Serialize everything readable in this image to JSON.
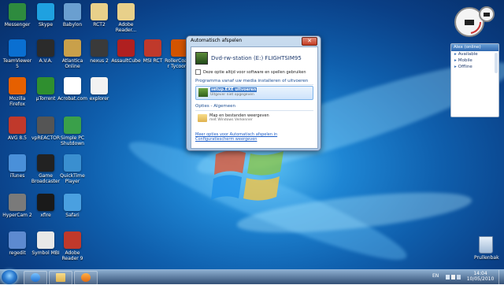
{
  "desktop_icons": [
    {
      "label": "Messenger",
      "color": "#2e8b3e",
      "icon": "messenger-icon"
    },
    {
      "label": "Skype",
      "color": "#1fa1e0",
      "icon": "skype-icon"
    },
    {
      "label": "Babylon",
      "color": "#6a9fd0",
      "icon": "babylon-icon"
    },
    {
      "label": "RCT2",
      "color": "#e8d08a",
      "icon": "folder-icon"
    },
    {
      "label": "Adobe Reader...",
      "color": "#e8d08a",
      "icon": "folder-icon"
    },
    {
      "label": "TeamViewer 5",
      "color": "#0a6fd1",
      "icon": "teamviewer-icon"
    },
    {
      "label": "A.V.A.",
      "color": "#2b2b2b",
      "icon": "ava-icon"
    },
    {
      "label": "Atlantica Online",
      "color": "#c9a04a",
      "icon": "atlantica-icon"
    },
    {
      "label": "nexus 2",
      "color": "#3a3a3a",
      "icon": "nexus-icon"
    },
    {
      "label": "AssaultCube",
      "color": "#b02020",
      "icon": "assaultcube-icon"
    },
    {
      "label": "MSI RCT",
      "color": "#c0392b",
      "icon": "msi-icon"
    },
    {
      "label": "RollerCoaster Tycoon 3",
      "color": "#d35400",
      "icon": "rct3-icon"
    },
    {
      "label": "Mozilla Firefox",
      "color": "#e66000",
      "icon": "firefox-icon"
    },
    {
      "label": "µTorrent",
      "color": "#2f8f2f",
      "icon": "utorrent-icon"
    },
    {
      "label": "Acrobat.com",
      "color": "#ffffff",
      "icon": "acrobat-icon"
    },
    {
      "label": "explorer",
      "color": "#f2f2f2",
      "icon": "explorer-icon"
    },
    {
      "label": "AVG 8.5",
      "color": "#c0392b",
      "icon": "avg-icon"
    },
    {
      "label": "vpREACTOR",
      "color": "#555555",
      "icon": "vpreactor-icon"
    },
    {
      "label": "Simple PC Shutdown",
      "color": "#3aa04a",
      "icon": "shutdown-icon"
    },
    {
      "label": "iTunes",
      "color": "#4a90d9",
      "icon": "itunes-icon"
    },
    {
      "label": "Game Broadcaster",
      "color": "#222222",
      "icon": "gamebroadcaster-icon"
    },
    {
      "label": "QuickTime Player",
      "color": "#3a8fd0",
      "icon": "quicktime-icon"
    },
    {
      "label": "HyperCam 2",
      "color": "#7a7a7a",
      "icon": "hypercam-icon"
    },
    {
      "label": "xfire",
      "color": "#1a1a1a",
      "icon": "xfire-icon"
    },
    {
      "label": "Safari",
      "color": "#4aa0e0",
      "icon": "safari-icon"
    },
    {
      "label": "regedit",
      "color": "#5d8ad0",
      "icon": "regedit-icon"
    },
    {
      "label": "Symbol MBI",
      "color": "#e8e8e8",
      "icon": "symbol-icon"
    },
    {
      "label": "Adobe Reader 9",
      "color": "#c0392b",
      "icon": "adobereader-icon"
    }
  ],
  "window": {
    "title": "Automatisch afspelen",
    "close": "✕",
    "drive_title": "Dvd-rw-station (E:) FLIGHTSIM95",
    "checkbox_label": "Deze optie altijd voor software en spellen gebruiken",
    "section_install": "Programma vanaf uw media installeren of uitvoeren",
    "option_setup_title": "setup.EXE uitvoeren",
    "option_setup_sub": "Uitgever niet opgegeven",
    "section_general": "Opties - Algemeen",
    "option_folder_title": "Map en bestanden weergeven",
    "option_folder_sub": "met Windows Verkenner",
    "link": "Meer opties voor Automatisch afspelen in Configuratiescherm weergeven"
  },
  "gadget": {
    "header": "Alex (online)",
    "statuses": [
      "Available",
      "Mobile",
      "Offline"
    ]
  },
  "recycle_bin": {
    "label": "Prullenbak"
  },
  "taskbar": {
    "language": "EN",
    "time": "14:04",
    "date": "10/05/2010"
  }
}
